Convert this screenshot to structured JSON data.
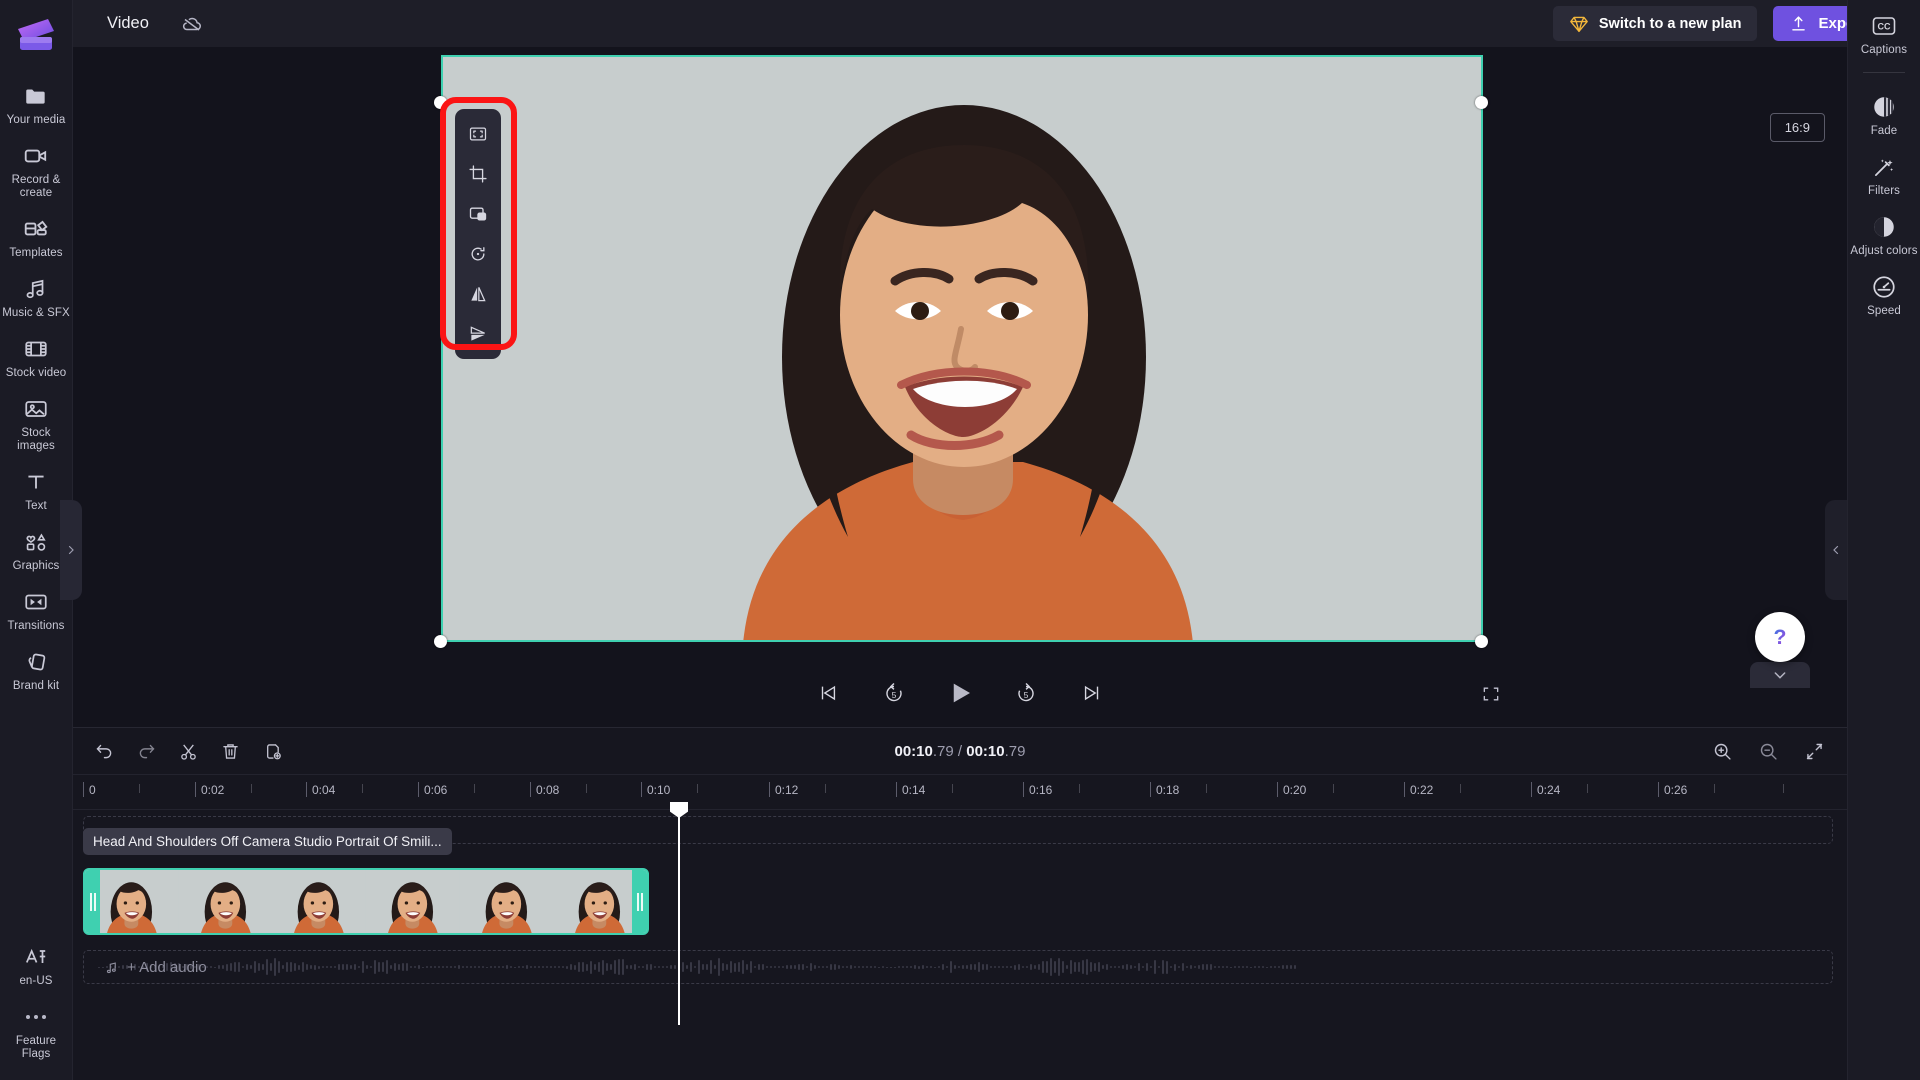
{
  "app": {
    "name": "Clipchamp",
    "accent": "#6f51e0",
    "selection_color": "#3fd0b0",
    "highlight_color": "#fb1414"
  },
  "topbar": {
    "project_title": "Video",
    "cloud_icon": "cloud-off-icon",
    "plan_button": {
      "label": "Switch to a new plan",
      "icon": "diamond-icon"
    },
    "export_button": {
      "label": "Export",
      "icon": "upload-icon",
      "chevron": "chevron-down-icon"
    }
  },
  "left_rail": {
    "logo_icon": "clipchamp-logo",
    "items": [
      {
        "label": "Your media",
        "icon": "folder-icon"
      },
      {
        "label": "Record & create",
        "icon": "video-camera-icon"
      },
      {
        "label": "Templates",
        "icon": "templates-icon"
      },
      {
        "label": "Music & SFX",
        "icon": "music-note-icon"
      },
      {
        "label": "Stock video",
        "icon": "film-strip-icon"
      },
      {
        "label": "Stock images",
        "icon": "image-icon"
      },
      {
        "label": "Text",
        "icon": "text-icon"
      },
      {
        "label": "Graphics",
        "icon": "graphics-icon"
      },
      {
        "label": "Transitions",
        "icon": "transitions-icon"
      },
      {
        "label": "Brand kit",
        "icon": "brand-kit-icon"
      }
    ],
    "bottom_items": [
      {
        "label": "en-US",
        "icon": "language-icon"
      },
      {
        "label": "Feature Flags",
        "icon": "more-dots-icon"
      }
    ]
  },
  "right_rail": {
    "captions": {
      "label": "Captions",
      "icon": "closed-captions-icon"
    },
    "items": [
      {
        "label": "Fade",
        "icon": "fade-icon"
      },
      {
        "label": "Filters",
        "icon": "magic-wand-icon"
      },
      {
        "label": "Adjust colors",
        "icon": "contrast-icon"
      },
      {
        "label": "Speed",
        "icon": "speedometer-icon"
      }
    ]
  },
  "stage": {
    "aspect_ratio": "16:9",
    "edit_toolbar": [
      {
        "name": "fit-to-frame",
        "icon": "fit-to-frame-icon"
      },
      {
        "name": "crop",
        "icon": "crop-icon"
      },
      {
        "name": "picture-in-picture",
        "icon": "picture-in-picture-icon"
      },
      {
        "name": "rotate",
        "icon": "rotate-icon"
      },
      {
        "name": "flip-horizontal",
        "icon": "flip-horizontal-icon"
      },
      {
        "name": "flip-vertical",
        "icon": "flip-vertical-icon"
      }
    ],
    "transport": [
      {
        "name": "skip-to-start",
        "icon": "skip-back-icon"
      },
      {
        "name": "rewind-5-seconds",
        "icon": "rewind-5-icon",
        "value": "5"
      },
      {
        "name": "play",
        "icon": "play-icon"
      },
      {
        "name": "forward-5-seconds",
        "icon": "forward-5-icon",
        "value": "5"
      },
      {
        "name": "skip-to-end",
        "icon": "skip-forward-icon"
      }
    ],
    "fullscreen": {
      "icon": "fullscreen-icon"
    },
    "help": {
      "icon": "question-mark-icon"
    }
  },
  "timeline": {
    "tools": [
      {
        "name": "undo",
        "icon": "undo-icon"
      },
      {
        "name": "redo",
        "icon": "redo-icon"
      },
      {
        "name": "split",
        "icon": "scissors-icon"
      },
      {
        "name": "delete",
        "icon": "trash-icon"
      },
      {
        "name": "duplicate",
        "icon": "duplicate-icon"
      }
    ],
    "current_time": "00:10",
    "current_time_frac": ".79",
    "total_time": "00:10",
    "total_time_frac": ".79",
    "time_separator": " / ",
    "zoom_tools": [
      {
        "name": "zoom-in",
        "icon": "zoom-in-icon"
      },
      {
        "name": "zoom-out",
        "icon": "zoom-out-icon"
      },
      {
        "name": "fit-timeline",
        "icon": "fit-timeline-icon"
      }
    ],
    "ruler_labels": [
      "0",
      "0:02",
      "0:04",
      "0:06",
      "0:08",
      "0:10",
      "0:12",
      "0:14",
      "0:16",
      "0:18",
      "0:20",
      "0:22",
      "0:24",
      "0:26"
    ],
    "clip": {
      "title": "Head And Shoulders Off Camera Studio Portrait Of Smili...",
      "thumb_count": 6
    },
    "audio_track": {
      "label": "+ Add audio",
      "icon": "music-note-icon"
    }
  }
}
